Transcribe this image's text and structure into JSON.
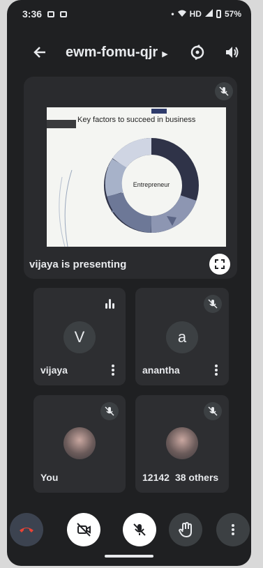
{
  "status_bar": {
    "time": "3:36",
    "network": "HD",
    "battery": "57%"
  },
  "header": {
    "meeting_code": "ewm-fomu-qjr"
  },
  "presentation": {
    "slide_title": "Key factors to succeed in business",
    "cycle_center": "Entrepreneur",
    "presenter_label": "vijaya is presenting"
  },
  "participants": [
    {
      "name": "vijaya",
      "avatar_letter": "V"
    },
    {
      "name": "anantha",
      "avatar_letter": "a"
    },
    {
      "name": "You"
    },
    {
      "name": "12142",
      "others": "38 others"
    }
  ],
  "colors": {
    "background": "#1f2022",
    "tile": "#2d2e31",
    "end_call": "#ea4335"
  },
  "icons": [
    "back-arrow-icon",
    "camera-switch-icon",
    "speaker-icon",
    "mic-off-icon",
    "fullscreen-icon",
    "more-vert-icon",
    "end-call-icon",
    "camera-off-icon",
    "raise-hand-icon"
  ]
}
